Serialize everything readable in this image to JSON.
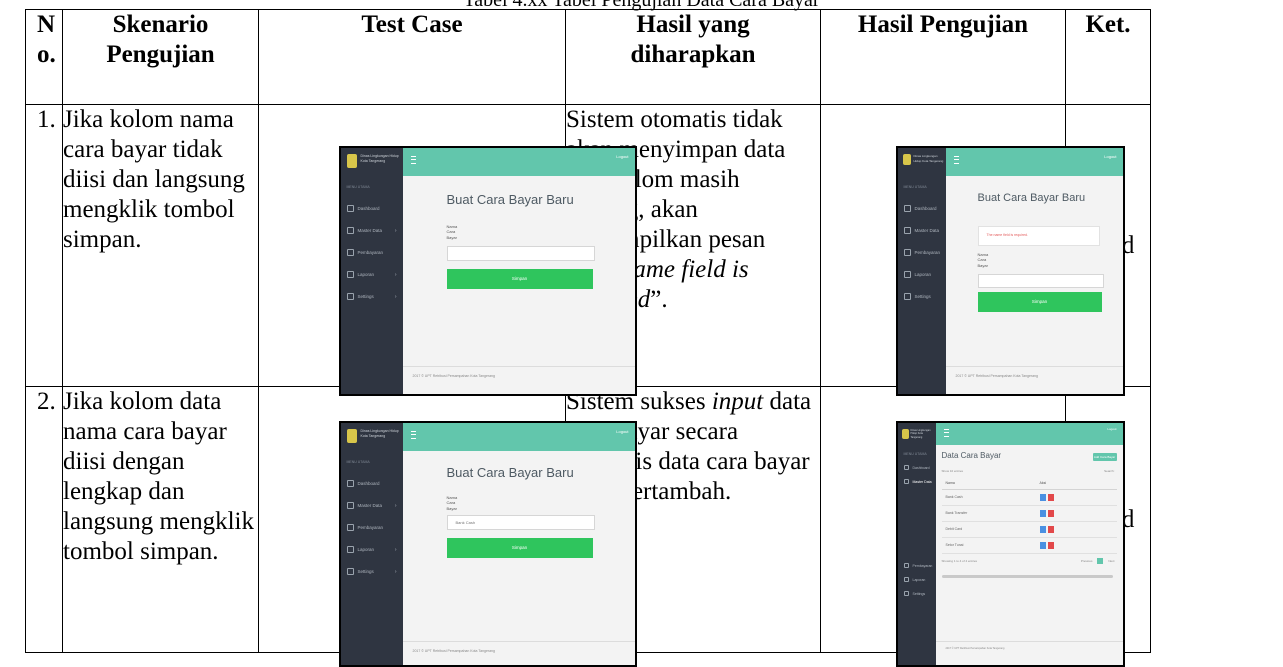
{
  "caption": "Tabel 4.xx Tabel Pengujian Data Cara Bayar",
  "headers": {
    "no": "No.",
    "skenario": "Skenario Pengujian",
    "test_case": "Test Case",
    "harapan": "Hasil yang diharapkan",
    "hasil": "Hasil Pengujian",
    "ket": "Ket."
  },
  "rows": [
    {
      "no": "1.",
      "skenario": "Jika kolom nama cara bayar tidak diisi dan langsung mengklik tombol simpan.",
      "harapan_pre": "Sistem otomatis tidak akan menyimpan data jika kolom masih kosong, akan menampilkan pesan “",
      "harapan_em": "The name field is required",
      "harapan_post": "”.",
      "ket": "Valid"
    },
    {
      "no": "2.",
      "skenario": "Jika kolom data nama cara bayar diisi dengan lengkap dan langsung mengklik tombol simpan.",
      "harapan_pre": "Sistem sukses ",
      "harapan_em": "input",
      "harapan_post": " data cara bayar secara otomatis data cara bayar akan bertambah.",
      "ket": "Valid"
    }
  ],
  "app": {
    "brand": "Dinas Lingkungan Hidup Kota Tangerang",
    "logout": "Logout",
    "menu_head": "MENU UTAMA",
    "menu": [
      "Dashboard",
      "Master Data",
      "Pembayaran",
      "Laporan",
      "Settings"
    ],
    "footer": "2017 © UPT Retribusi Persampahan Kota Tangerang"
  },
  "form": {
    "title": "Buat Cara Bayar Baru",
    "label": "Nama Cara Bayar",
    "filled_value": "Bank Cash",
    "button": "Simpan",
    "error": "The name field is required."
  },
  "list": {
    "title": "Data Cara Bayar",
    "add_button": "Add Cara Bayar",
    "show_label": "Show 10 entries",
    "search_label": "Search:",
    "col_name": "Nama",
    "col_aksi": "Aksi",
    "entries": [
      "Bank Cash",
      "Bank Transfer",
      "Debit Card",
      "Setor Tunai"
    ],
    "info": "Showing 1 to 4 of 4 entries",
    "pager": [
      "Previous",
      "1",
      "Next"
    ]
  }
}
